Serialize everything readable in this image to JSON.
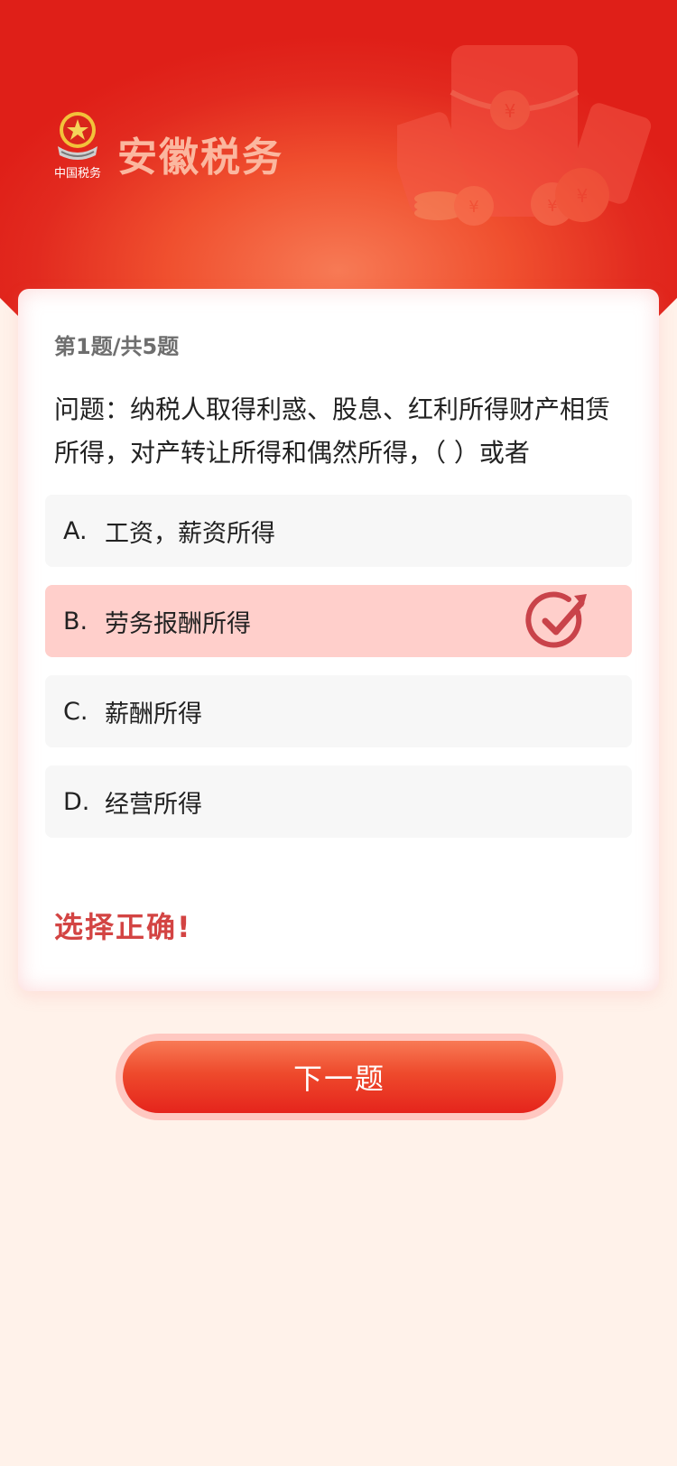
{
  "header": {
    "brand": "安徽税务",
    "logo_icon": "tax-emblem-icon",
    "logo_caption": "中国税务"
  },
  "quiz": {
    "progress": "第1题/共5题",
    "question": "问题：纳税人取得利惑、股息、红利所得财产相赁所得，对产转让所得和偶然所得，（  ）或者",
    "options": [
      {
        "letter": "A.",
        "text": "工资，薪资所得",
        "state": "default"
      },
      {
        "letter": "B.",
        "text": "劳务报酬所得",
        "state": "correct-selected"
      },
      {
        "letter": "C.",
        "text": "薪酬所得",
        "state": "default"
      },
      {
        "letter": "D.",
        "text": "经营所得",
        "state": "default"
      }
    ],
    "result": "选择正确!"
  },
  "actions": {
    "next_label": "下一题"
  },
  "colors": {
    "hero": "#e22a1f",
    "accent": "#d34443",
    "correct_bg": "#ffcfcb",
    "page_bg": "#fff2ea"
  }
}
